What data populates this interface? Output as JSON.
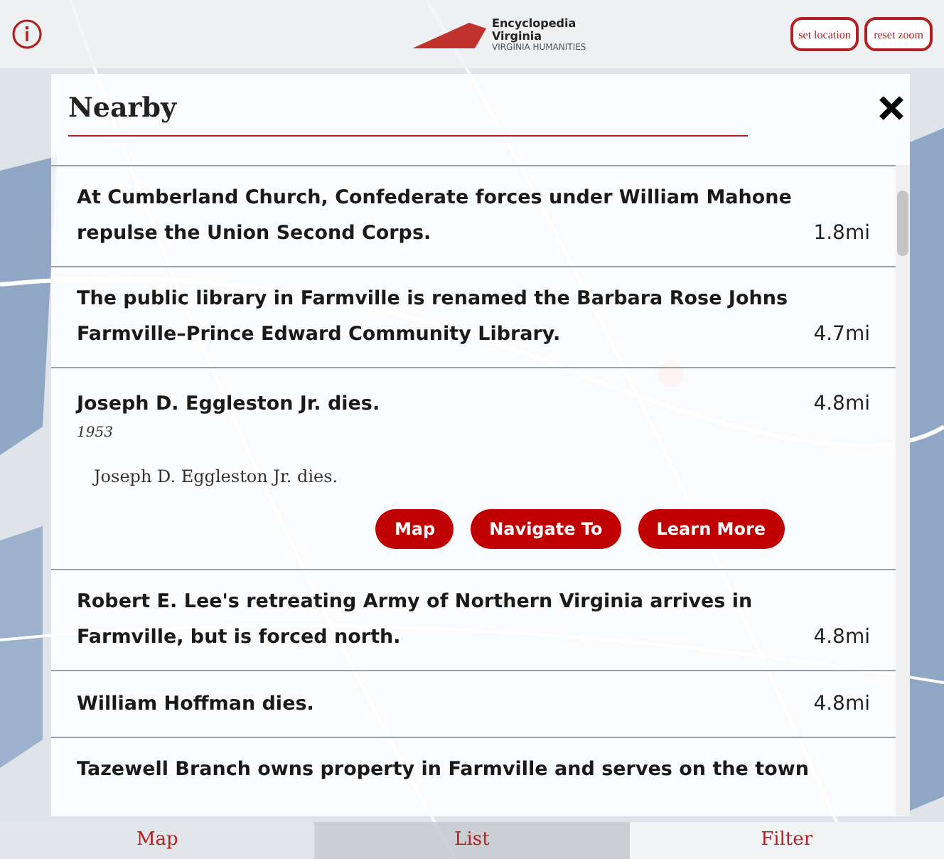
{
  "header": {
    "logo_title": "Encyclopedia Virginia",
    "logo_subtitle": "VIRGINIA HUMANITIES",
    "buttons": [
      "set location",
      "reset zoom"
    ]
  },
  "panel": {
    "title": "Nearby",
    "items": [
      {
        "title": "At Cumberland Church, Confederate forces under William Mahone repulse the Union Second Corps.",
        "distance": "1.8mi",
        "expanded": false
      },
      {
        "title": "The public library in Farmville is renamed the Barbara Rose Johns Farmville–Prince Edward Community Library.",
        "distance": "4.7mi",
        "expanded": false
      },
      {
        "title": "Joseph D. Eggleston Jr. dies.",
        "distance": "4.8mi",
        "expanded": true,
        "year": "1953",
        "description": "Joseph D. Eggleston Jr. dies.",
        "actions": [
          "Map",
          "Navigate To",
          "Learn More"
        ]
      },
      {
        "title": "Robert E. Lee's retreating Army of Northern Virginia arrives in Farmville, but is forced north.",
        "distance": "4.8mi",
        "expanded": false
      },
      {
        "title": "William Hoffman dies.",
        "distance": "4.8mi",
        "expanded": false
      },
      {
        "title": "Tazewell Branch owns property in Farmville and serves on the town",
        "expanded": false
      }
    ]
  },
  "tabs": [
    {
      "label": "Map",
      "selected": false
    },
    {
      "label": "List",
      "selected": true
    },
    {
      "label": "Filter",
      "selected": false
    }
  ]
}
